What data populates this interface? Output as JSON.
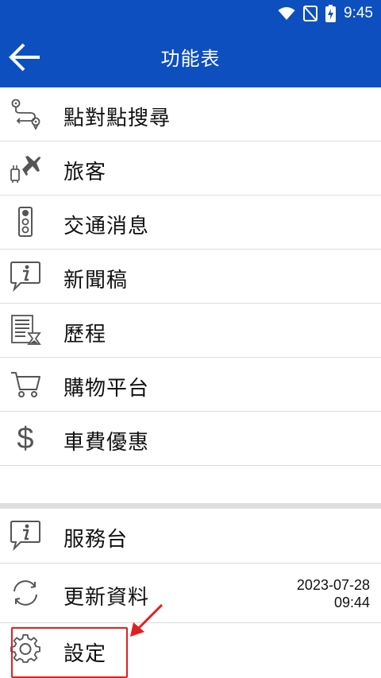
{
  "status_bar": {
    "time": "9:45"
  },
  "app_bar": {
    "title": "功能表",
    "back_icon": "arrow-left-icon"
  },
  "menu_items": [
    {
      "label": "點對點搜尋",
      "icon": "route-search-icon"
    },
    {
      "label": "旅客",
      "icon": "traveler-plane-icon"
    },
    {
      "label": "交通消息",
      "icon": "traffic-light-icon"
    },
    {
      "label": "新聞稿",
      "icon": "info-bubble-icon"
    },
    {
      "label": "歷程",
      "icon": "history-list-icon"
    },
    {
      "label": "購物平台",
      "icon": "shopping-cart-icon"
    },
    {
      "label": "車費優惠",
      "icon": "dollar-icon"
    }
  ],
  "bottom_items": [
    {
      "label": "服務台",
      "icon": "info-bubble-icon"
    },
    {
      "label": "更新資料",
      "icon": "sync-icon",
      "date": "2023-07-28",
      "time": "09:44"
    },
    {
      "label": "設定",
      "icon": "gear-icon"
    }
  ],
  "colors": {
    "app_bar": "#0d4fbf",
    "highlight": "#e02020",
    "icon": "#555555"
  }
}
